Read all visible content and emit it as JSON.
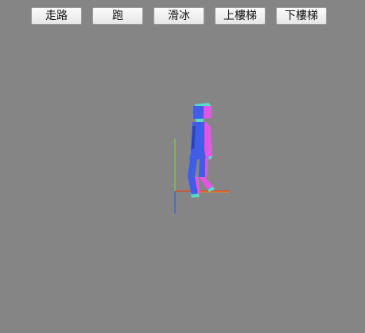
{
  "toolbar": {
    "buttons": [
      {
        "label": "走路"
      },
      {
        "label": "跑"
      },
      {
        "label": "滑冰"
      },
      {
        "label": "上樓梯"
      },
      {
        "label": "下樓梯"
      }
    ]
  },
  "scene": {
    "background_color": "#858585",
    "axis_colors": {
      "x": "#e0441b",
      "y": "#7bd147",
      "z": "#3a63d8"
    },
    "figure_colors": {
      "front": "#3f5de6",
      "side": "#e256e6",
      "top": "#59d9c8",
      "shade": "#2c44b8"
    }
  }
}
